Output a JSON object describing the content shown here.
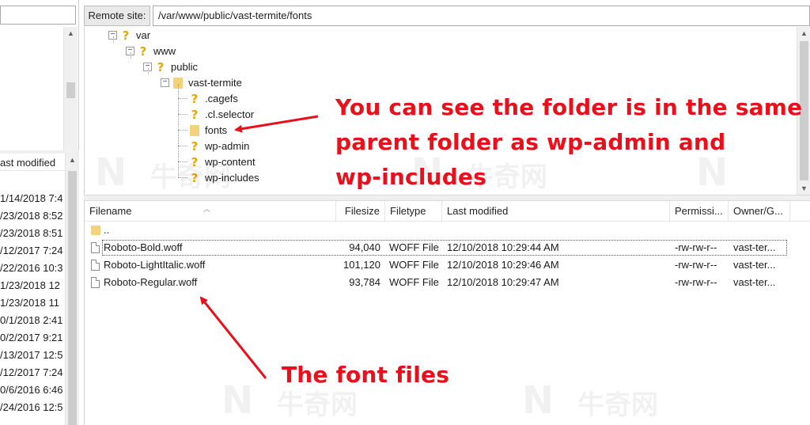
{
  "local_pane": {
    "columns": {
      "last_modified": "ast modified"
    },
    "rows": [
      "1/14/2018 7:4",
      "/23/2018 8:52",
      "/23/2018 8:51",
      "/12/2017 7:24",
      "/22/2016 10:3",
      "1/23/2018 12",
      "1/23/2018 11",
      "0/1/2018 2:41",
      "0/2/2017 9:21",
      "/13/2017 12:5",
      "/12/2017 7:24",
      "0/6/2016 6:46",
      "/24/2016 12:5"
    ]
  },
  "remote_bar": {
    "label": "Remote site:",
    "path": "/var/www/public/vast-termite/fonts"
  },
  "tree": [
    {
      "label": "var",
      "icon": "question-icon",
      "expander": "⊟"
    },
    {
      "label": "www",
      "icon": "question-icon",
      "expander": "⊟"
    },
    {
      "label": "public",
      "icon": "question-icon",
      "expander": "⊟"
    },
    {
      "label": "vast-termite",
      "icon": "folder-icon",
      "expander": "⊟"
    },
    {
      "label": ".cagefs",
      "icon": "question-icon"
    },
    {
      "label": ".cl.selector",
      "icon": "question-icon"
    },
    {
      "label": "fonts",
      "icon": "folder-icon"
    },
    {
      "label": "wp-admin",
      "icon": "question-icon"
    },
    {
      "label": "wp-content",
      "icon": "question-icon"
    },
    {
      "label": "wp-includes",
      "icon": "question-icon"
    }
  ],
  "file_list": {
    "columns": {
      "filename": "Filename",
      "filesize": "Filesize",
      "filetype": "Filetype",
      "last_modified": "Last modified",
      "permissions": "Permissi...",
      "owner": "Owner/G..."
    },
    "parent_row": "..",
    "rows": [
      {
        "name": "Roboto-Bold.woff",
        "size": "94,040",
        "type": "WOFF File",
        "modified": "12/10/2018 10:29:44 AM",
        "perms": "-rw-rw-r--",
        "owner": "vast-ter..."
      },
      {
        "name": "Roboto-LightItalic.woff",
        "size": "101,120",
        "type": "WOFF File",
        "modified": "12/10/2018 10:29:46 AM",
        "perms": "-rw-rw-r--",
        "owner": "vast-ter..."
      },
      {
        "name": "Roboto-Regular.woff",
        "size": "93,784",
        "type": "WOFF File",
        "modified": "12/10/2018 10:29:47 AM",
        "perms": "-rw-rw-r--",
        "owner": "vast-ter..."
      }
    ]
  },
  "annotations": {
    "folder_note_lines": [
      "You can see the folder is in the same",
      "parent folder as wp-admin and",
      "wp-includes"
    ],
    "files_note": "The font files",
    "color": "#e8101a"
  },
  "watermark": {
    "glyph": "N",
    "text": "牛奇网"
  }
}
